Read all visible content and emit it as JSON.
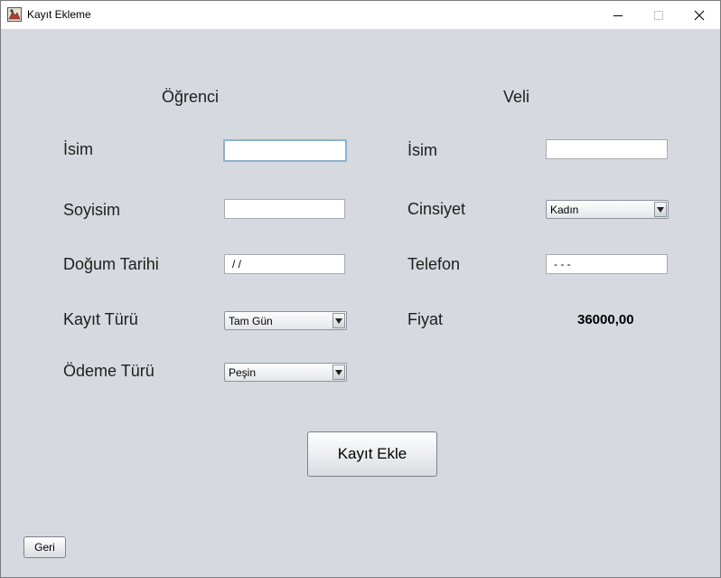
{
  "window": {
    "title": "Kayıt Ekleme"
  },
  "student": {
    "header": "Öğrenci",
    "name_label": "İsim",
    "name_value": "",
    "surname_label": "Soyisim",
    "surname_value": "",
    "birthdate_label": "Doğum Tarihi",
    "birthdate_value": " / /",
    "registration_type_label": "Kayıt Türü",
    "registration_type_value": "Tam Gün",
    "payment_type_label": "Ödeme Türü",
    "payment_type_value": "Peşin"
  },
  "parent": {
    "header": "Veli",
    "name_label": "İsim",
    "name_value": "",
    "gender_label": "Cinsiyet",
    "gender_value": "Kadın",
    "phone_label": "Telefon",
    "phone_value": " -  - -",
    "price_label": "Fiyat",
    "price_value": "36000,00"
  },
  "actions": {
    "add_label": "Kayıt Ekle",
    "back_label": "Geri"
  },
  "icons": {
    "app": "app-icon",
    "minimize": "minimize-icon",
    "maximize": "maximize-icon",
    "close": "close-icon",
    "dropdown": "chevron-down-icon"
  },
  "colors": {
    "background": "#d6d9df",
    "titlebar": "#ffffff",
    "focus_border": "#8fb1cc"
  }
}
